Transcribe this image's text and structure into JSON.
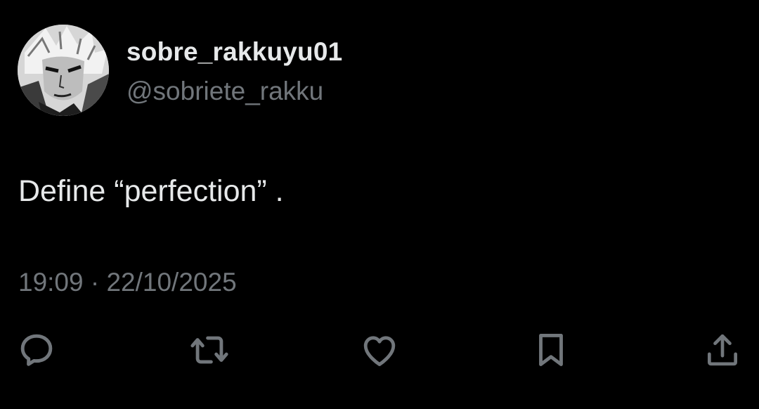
{
  "tweet": {
    "display_name": "sobre_rakkuyu01",
    "handle": "@sobriete_rakku",
    "text": "Define “perfection” .",
    "timestamp": "19:09 · 22/10/2025"
  },
  "actions": [
    {
      "icon": "reply-icon"
    },
    {
      "icon": "retweet-icon"
    },
    {
      "icon": "like-icon"
    },
    {
      "icon": "bookmark-icon"
    },
    {
      "icon": "share-icon"
    }
  ],
  "colors": {
    "background": "#000000",
    "primary_text": "#e7e9ea",
    "secondary_text": "#71767b"
  }
}
